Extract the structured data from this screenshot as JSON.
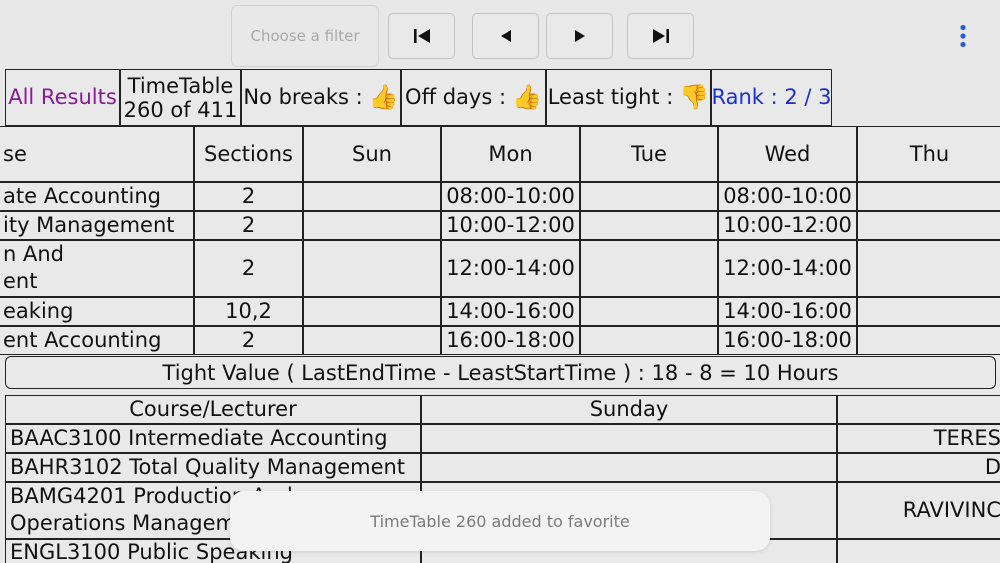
{
  "toolbar": {
    "filter_placeholder": "Choose a filter",
    "nav_icons": [
      "first-page-icon",
      "previous-icon",
      "next-icon",
      "last-page-icon"
    ],
    "menu_icon": "more-vertical-icon"
  },
  "summary": {
    "all_results": "All Results",
    "timetable_line1": "TimeTable",
    "timetable_line2": "260 of 411",
    "no_breaks": "No breaks :",
    "off_days": "Off days :",
    "least_tight": "Least tight :",
    "rank": "Rank : 2 / 3",
    "no_breaks_icon": "thumbs-up-icon",
    "off_days_icon": "thumbs-up-icon",
    "least_tight_icon": "thumbs-down-icon"
  },
  "schedule": {
    "headers": [
      "se",
      "Sections",
      "Sun",
      "Mon",
      "Tue",
      "Wed",
      "Thu"
    ],
    "rows": [
      {
        "course_line1": "ate Accounting",
        "course_line2": "",
        "sections": "2",
        "sun": "",
        "mon": "08:00-10:00",
        "tue": "",
        "wed": "08:00-10:00",
        "thu": ""
      },
      {
        "course_line1": "ity Management",
        "course_line2": "",
        "sections": "2",
        "sun": "",
        "mon": "10:00-12:00",
        "tue": "",
        "wed": "10:00-12:00",
        "thu": ""
      },
      {
        "course_line1": "n And",
        "course_line2": "ent",
        "sections": "2",
        "sun": "",
        "mon": "12:00-14:00",
        "tue": "",
        "wed": "12:00-14:00",
        "thu": ""
      },
      {
        "course_line1": "eaking",
        "course_line2": "",
        "sections": "10,2",
        "sun": "",
        "mon": "14:00-16:00",
        "tue": "",
        "wed": "14:00-16:00",
        "thu": ""
      },
      {
        "course_line1": "ent Accounting",
        "course_line2": "",
        "sections": "2",
        "sun": "",
        "mon": "16:00-18:00",
        "tue": "",
        "wed": "16:00-18:00",
        "thu": ""
      }
    ]
  },
  "tight_value": "Tight Value ( LastEndTime - LeastStartTime ) : 18 - 8 = 10 Hours",
  "lecturers": {
    "headers": [
      "Course/Lecturer",
      "Sunday",
      ""
    ],
    "rows": [
      {
        "course_line1": "BAAC3100 Intermediate Accounting",
        "course_line2": "",
        "sunday": "",
        "next": "TERES"
      },
      {
        "course_line1": "BAHR3102 Total Quality Management",
        "course_line2": "",
        "sunday": "",
        "next": "D"
      },
      {
        "course_line1": "BAMG4201 Production And",
        "course_line2": "Operations Management",
        "sunday": "",
        "next": "RAVIVINC"
      },
      {
        "course_line1": "ENGL3100 Public Speaking",
        "course_line2": "",
        "sunday": "",
        "next": ""
      }
    ]
  },
  "toast": "TimeTable 260 added to favorite"
}
